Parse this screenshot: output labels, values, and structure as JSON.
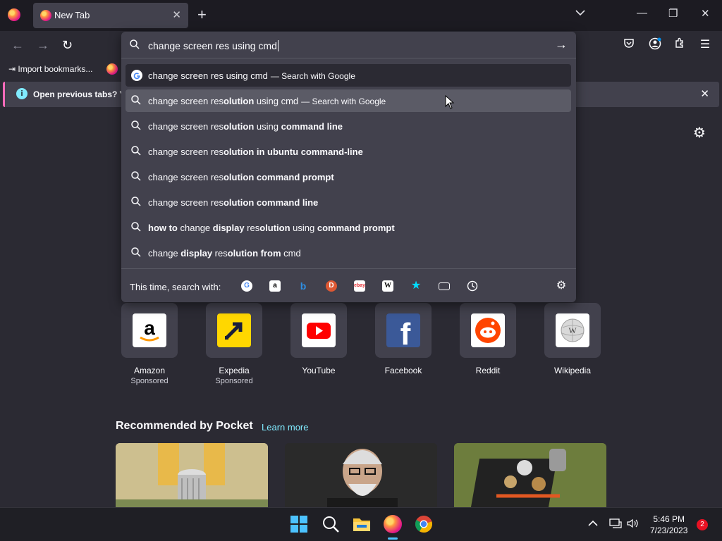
{
  "tab": {
    "title": "New Tab"
  },
  "bookmarks": {
    "import_label": "Import bookmarks..."
  },
  "notification": {
    "text": "Open previous tabs? You"
  },
  "urlbar": {
    "value": "change screen res using cmd",
    "search_with_label": "This time, search with:"
  },
  "suggestions": [
    {
      "parts": [
        [
          "n",
          "change screen res using cmd"
        ]
      ],
      "suffix": "— Search with Google",
      "type": "google"
    },
    {
      "parts": [
        [
          "n",
          "change screen res"
        ],
        [
          "b",
          "olution"
        ],
        [
          "n",
          " using cmd"
        ]
      ],
      "suffix": "— Search with Google",
      "type": "search"
    },
    {
      "parts": [
        [
          "n",
          "change screen res"
        ],
        [
          "b",
          "olution"
        ],
        [
          "n",
          " using "
        ],
        [
          "b",
          "command line"
        ]
      ],
      "suffix": "",
      "type": "search"
    },
    {
      "parts": [
        [
          "n",
          "change screen res"
        ],
        [
          "b",
          "olution in ubuntu command-line"
        ]
      ],
      "suffix": "",
      "type": "search"
    },
    {
      "parts": [
        [
          "n",
          "change screen res"
        ],
        [
          "b",
          "olution command prompt"
        ]
      ],
      "suffix": "",
      "type": "search"
    },
    {
      "parts": [
        [
          "n",
          "change screen res"
        ],
        [
          "b",
          "olution command line"
        ]
      ],
      "suffix": "",
      "type": "search"
    },
    {
      "parts": [
        [
          "b",
          "how to"
        ],
        [
          "n",
          " change "
        ],
        [
          "b",
          "display"
        ],
        [
          "n",
          " res"
        ],
        [
          "b",
          "olution"
        ],
        [
          "n",
          " using "
        ],
        [
          "b",
          "command prompt"
        ]
      ],
      "suffix": "",
      "type": "search"
    },
    {
      "parts": [
        [
          "n",
          "change "
        ],
        [
          "b",
          "display"
        ],
        [
          "n",
          " res"
        ],
        [
          "b",
          "olution from"
        ],
        [
          "n",
          " cmd"
        ]
      ],
      "suffix": "",
      "type": "search"
    }
  ],
  "top_sites": [
    {
      "name": "Amazon",
      "sponsored": "Sponsored",
      "color": "#ffffff"
    },
    {
      "name": "Expedia",
      "sponsored": "Sponsored",
      "color": "#ffd700"
    },
    {
      "name": "YouTube",
      "sponsored": "",
      "color": "#ffffff"
    },
    {
      "name": "Facebook",
      "sponsored": "",
      "color": "#3b5998"
    },
    {
      "name": "Reddit",
      "sponsored": "",
      "color": "#ffffff"
    },
    {
      "name": "Wikipedia",
      "sponsored": "",
      "color": "#ffffff"
    }
  ],
  "pocket": {
    "title": "Recommended by Pocket",
    "learn_more": "Learn more"
  },
  "taskbar": {
    "time": "5:46 PM",
    "date": "7/23/2023",
    "notifications": "2"
  },
  "colors": {
    "accent": "#80ebff",
    "panel": "#42414d",
    "background": "#2b2a33",
    "notif_accent": "#ff6bba"
  }
}
